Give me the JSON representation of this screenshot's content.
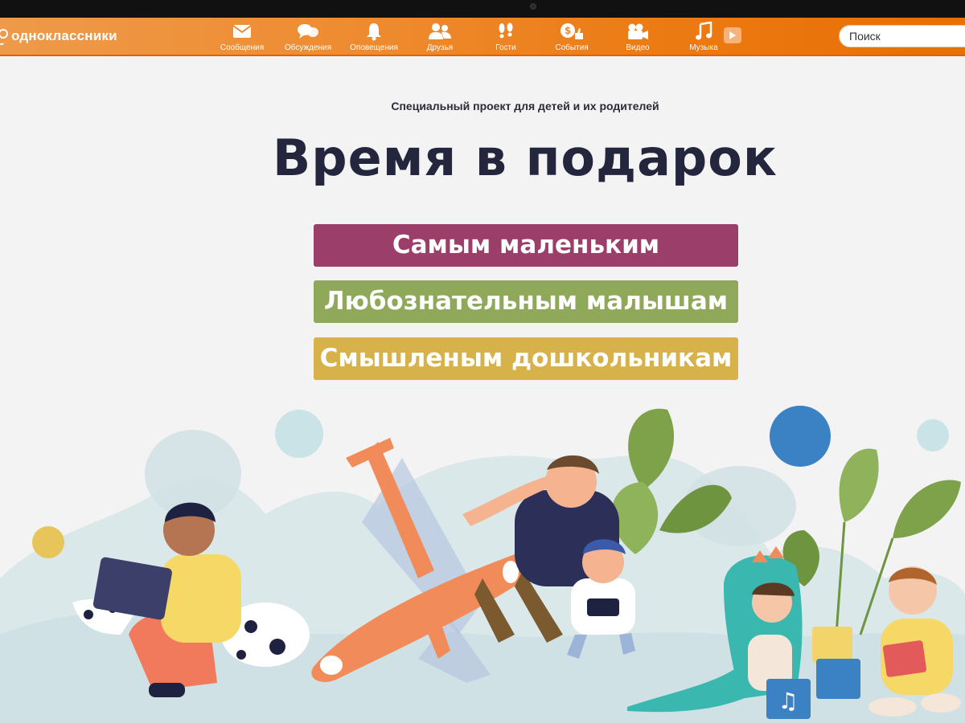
{
  "app": {
    "logo_text": "одноклассники"
  },
  "nav": {
    "items": [
      {
        "label": "Сообщения",
        "icon": "envelope-icon"
      },
      {
        "label": "Обсуждения",
        "icon": "chat-bubbles-icon"
      },
      {
        "label": "Оповещения",
        "icon": "bell-icon"
      },
      {
        "label": "Друзья",
        "icon": "friends-icon"
      },
      {
        "label": "Гости",
        "icon": "footprints-icon"
      },
      {
        "label": "События",
        "icon": "events-icon"
      },
      {
        "label": "Видео",
        "icon": "video-camera-icon"
      },
      {
        "label": "Музыка",
        "icon": "music-note-icon"
      }
    ],
    "extra_icon": "play-icon"
  },
  "search": {
    "placeholder": "Поиск",
    "value": ""
  },
  "page": {
    "subtitle": "Специальный проект для детей и их родителей",
    "headline": "Время в подарок",
    "buttons": [
      {
        "label": "Самым маленьким",
        "color": "#9c3e6a"
      },
      {
        "label": "Любознательным малышам",
        "color": "#8fa85a"
      },
      {
        "label": "Смышленым дошкольникам",
        "color": "#d7b24a"
      }
    ]
  },
  "colors": {
    "topbar": "#ee8a2e",
    "background": "#f3f3f3",
    "headline": "#23263d"
  }
}
